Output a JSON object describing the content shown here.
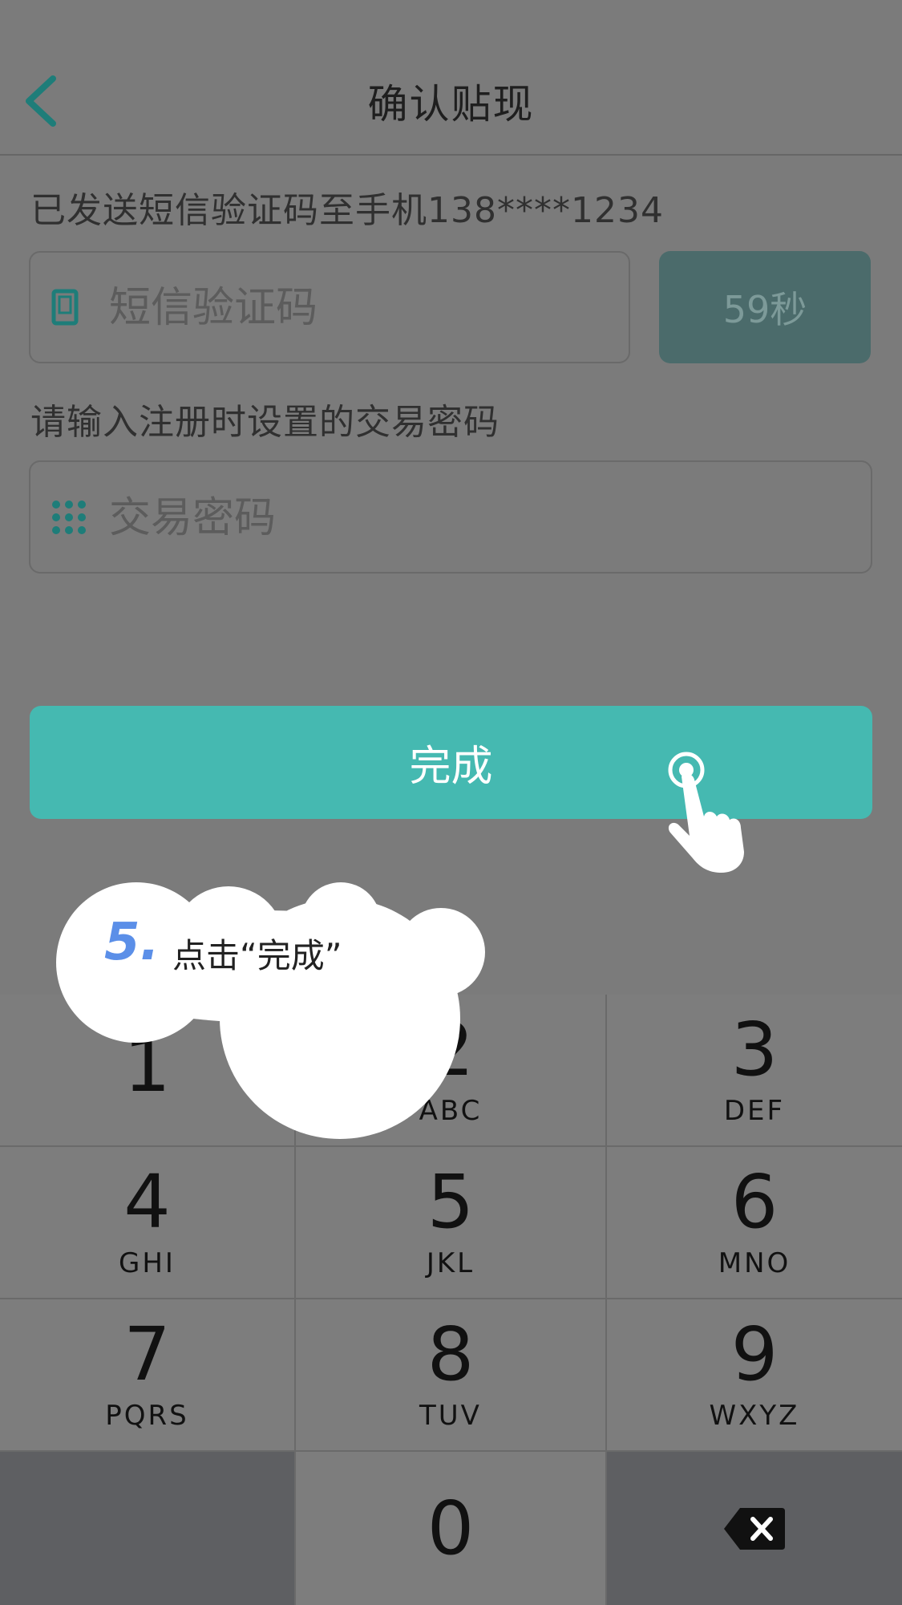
{
  "header": {
    "title": "确认贴现",
    "back_icon": "chevron-left-icon"
  },
  "sms": {
    "note": "已发送短信验证码至手机138****1234",
    "placeholder": "短信验证码",
    "timer_label": "59秒",
    "icon": "phone-icon"
  },
  "password": {
    "note": "请输入注册时设置的交易密码",
    "placeholder": "交易密码",
    "icon": "keypad-grid-icon"
  },
  "done_button": {
    "label": "完成"
  },
  "tutorial": {
    "step": "5.",
    "text": "点击“完成”"
  },
  "keypad": {
    "keys": [
      {
        "digit": "1",
        "letters": ""
      },
      {
        "digit": "2",
        "letters": "ABC"
      },
      {
        "digit": "3",
        "letters": "DEF"
      },
      {
        "digit": "4",
        "letters": "GHI"
      },
      {
        "digit": "5",
        "letters": "JKL"
      },
      {
        "digit": "6",
        "letters": "MNO"
      },
      {
        "digit": "7",
        "letters": "PQRS"
      },
      {
        "digit": "8",
        "letters": "TUV"
      },
      {
        "digit": "9",
        "letters": "WXYZ"
      },
      {
        "digit": "0",
        "letters": ""
      }
    ],
    "delete_icon": "backspace-icon"
  },
  "colors": {
    "accent": "#45b9b1",
    "timer_bg": "#4b6b6b",
    "tip_number": "#5b8fe8"
  }
}
